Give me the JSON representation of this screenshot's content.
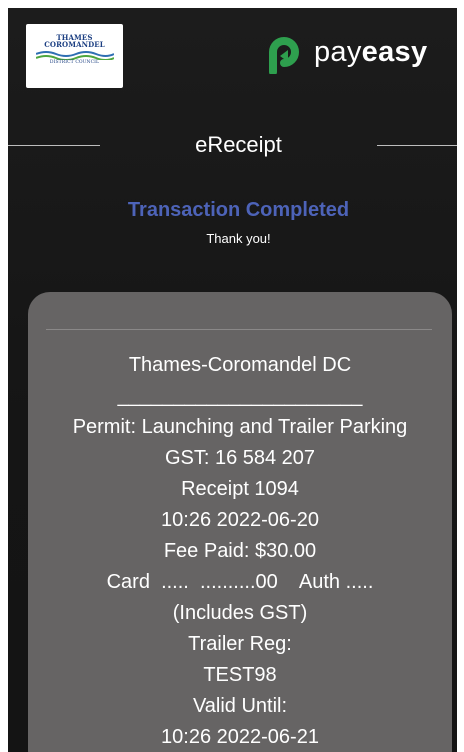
{
  "header": {
    "council_logo": {
      "line1": "THAMES",
      "line2": "COROMANDEL",
      "line3": "DISTRICT COUNCIL",
      "colors": {
        "text": "#1c3f82",
        "wave_blue": "#2f6fb3",
        "wave_green": "#4ea63f"
      }
    },
    "brand": {
      "icon": "payeasy-logo-icon",
      "name_part1": "pay",
      "name_part2": "easy",
      "accent": "#2e9f4e"
    }
  },
  "receipt": {
    "title": "eReceipt",
    "status": "Transaction Completed",
    "status_color": "#4d63b8",
    "message": "Thank you!"
  },
  "card": {
    "merchant": "Thames-Coromandel DC",
    "divider": "______________________",
    "permit": "Permit: Launching and Trailer Parking",
    "gst": "GST: 16 584 207",
    "receipt_number": "Receipt 1094",
    "datetime": "10:26 2022-06-20",
    "fee_paid": "Fee Paid: $30.00",
    "card_details": "Card  .....  ..........00    Auth .....",
    "includes_gst": "(Includes GST)",
    "trailer_reg_label": "Trailer Reg:",
    "trailer_reg": "TEST98",
    "valid_until_label": "Valid Until:",
    "valid_until": "10:26 2022-06-21",
    "background": "#666464"
  }
}
